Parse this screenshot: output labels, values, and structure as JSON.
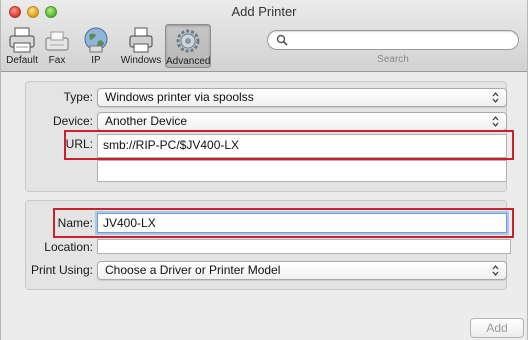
{
  "window": {
    "title": "Add Printer"
  },
  "toolbar": {
    "items": [
      {
        "label": "Default",
        "icon": "printer-default-icon"
      },
      {
        "label": "Fax",
        "icon": "fax-icon"
      },
      {
        "label": "IP",
        "icon": "globe-icon"
      },
      {
        "label": "Windows",
        "icon": "windows-printer-icon"
      },
      {
        "label": "Advanced",
        "icon": "gear-icon",
        "active": true
      }
    ],
    "search": {
      "label": "Search",
      "value": ""
    }
  },
  "form": {
    "type": {
      "label": "Type:",
      "value": "Windows printer via spoolss"
    },
    "device": {
      "label": "Device:",
      "value": "Another Device"
    },
    "url": {
      "label": "URL:",
      "value": "smb://RIP-PC/$JV400-LX"
    },
    "name": {
      "label": "Name:",
      "value": "JV400-LX"
    },
    "location": {
      "label": "Location:",
      "value": ""
    },
    "print_using": {
      "label": "Print Using:",
      "value": "Choose a Driver or Printer Model"
    }
  },
  "buttons": {
    "add": "Add"
  },
  "colors": {
    "highlight_box": "#c8232c",
    "focus_ring": "#a9c8ee"
  }
}
